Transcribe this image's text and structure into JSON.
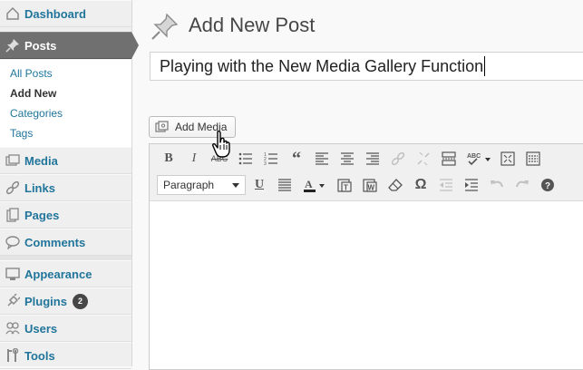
{
  "sidebar": {
    "items": [
      {
        "label": "Dashboard",
        "icon": "dashboard-icon"
      },
      {
        "label": "Posts",
        "icon": "pushpin-icon",
        "active": true
      },
      {
        "label": "Media",
        "icon": "media-icon"
      },
      {
        "label": "Links",
        "icon": "links-icon"
      },
      {
        "label": "Pages",
        "icon": "pages-icon"
      },
      {
        "label": "Comments",
        "icon": "comments-icon"
      },
      {
        "label": "Appearance",
        "icon": "appearance-icon"
      },
      {
        "label": "Plugins",
        "icon": "plugins-icon",
        "badge": "2"
      },
      {
        "label": "Users",
        "icon": "users-icon"
      },
      {
        "label": "Tools",
        "icon": "tools-icon"
      }
    ],
    "posts_submenu": [
      "All Posts",
      "Add New",
      "Categories",
      "Tags"
    ],
    "current_submenu": "Add New"
  },
  "main": {
    "page_title": "Add New Post",
    "title_value": "Playing with the New Media Gallery Function",
    "add_media_label": "Add Media",
    "format_select_value": "Paragraph"
  },
  "toolbar": {
    "row1": [
      "bold-icon",
      "italic-icon",
      "strikethrough-icon",
      "bullet-list-icon",
      "numbered-list-icon",
      "blockquote-icon",
      "align-left-icon",
      "align-center-icon",
      "align-right-icon",
      "link-icon",
      "unlink-icon",
      "read-more-icon",
      "spellcheck-icon",
      "fullscreen-icon",
      "kitchen-sink-icon"
    ],
    "row2": [
      "underline-icon",
      "justify-icon",
      "text-color-icon",
      "paste-text-icon",
      "paste-word-icon",
      "clear-formatting-icon",
      "special-character-icon",
      "outdent-icon",
      "indent-icon",
      "undo-icon",
      "redo-icon",
      "help-icon"
    ]
  },
  "colors": {
    "link": "#21759b",
    "active_menu": "#707070",
    "sidebar_bg": "#efefef",
    "toolbar_bg": "#f0f0f0"
  }
}
